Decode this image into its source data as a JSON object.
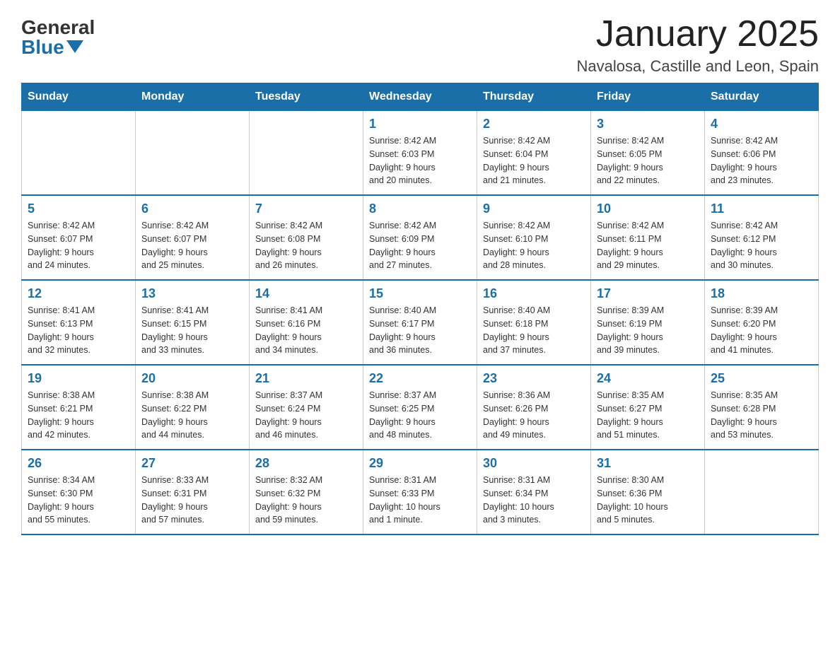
{
  "header": {
    "logo_general": "General",
    "logo_blue": "Blue",
    "month_title": "January 2025",
    "location": "Navalosa, Castille and Leon, Spain"
  },
  "weekdays": [
    "Sunday",
    "Monday",
    "Tuesday",
    "Wednesday",
    "Thursday",
    "Friday",
    "Saturday"
  ],
  "weeks": [
    [
      {
        "day": "",
        "info": ""
      },
      {
        "day": "",
        "info": ""
      },
      {
        "day": "",
        "info": ""
      },
      {
        "day": "1",
        "info": "Sunrise: 8:42 AM\nSunset: 6:03 PM\nDaylight: 9 hours\nand 20 minutes."
      },
      {
        "day": "2",
        "info": "Sunrise: 8:42 AM\nSunset: 6:04 PM\nDaylight: 9 hours\nand 21 minutes."
      },
      {
        "day": "3",
        "info": "Sunrise: 8:42 AM\nSunset: 6:05 PM\nDaylight: 9 hours\nand 22 minutes."
      },
      {
        "day": "4",
        "info": "Sunrise: 8:42 AM\nSunset: 6:06 PM\nDaylight: 9 hours\nand 23 minutes."
      }
    ],
    [
      {
        "day": "5",
        "info": "Sunrise: 8:42 AM\nSunset: 6:07 PM\nDaylight: 9 hours\nand 24 minutes."
      },
      {
        "day": "6",
        "info": "Sunrise: 8:42 AM\nSunset: 6:07 PM\nDaylight: 9 hours\nand 25 minutes."
      },
      {
        "day": "7",
        "info": "Sunrise: 8:42 AM\nSunset: 6:08 PM\nDaylight: 9 hours\nand 26 minutes."
      },
      {
        "day": "8",
        "info": "Sunrise: 8:42 AM\nSunset: 6:09 PM\nDaylight: 9 hours\nand 27 minutes."
      },
      {
        "day": "9",
        "info": "Sunrise: 8:42 AM\nSunset: 6:10 PM\nDaylight: 9 hours\nand 28 minutes."
      },
      {
        "day": "10",
        "info": "Sunrise: 8:42 AM\nSunset: 6:11 PM\nDaylight: 9 hours\nand 29 minutes."
      },
      {
        "day": "11",
        "info": "Sunrise: 8:42 AM\nSunset: 6:12 PM\nDaylight: 9 hours\nand 30 minutes."
      }
    ],
    [
      {
        "day": "12",
        "info": "Sunrise: 8:41 AM\nSunset: 6:13 PM\nDaylight: 9 hours\nand 32 minutes."
      },
      {
        "day": "13",
        "info": "Sunrise: 8:41 AM\nSunset: 6:15 PM\nDaylight: 9 hours\nand 33 minutes."
      },
      {
        "day": "14",
        "info": "Sunrise: 8:41 AM\nSunset: 6:16 PM\nDaylight: 9 hours\nand 34 minutes."
      },
      {
        "day": "15",
        "info": "Sunrise: 8:40 AM\nSunset: 6:17 PM\nDaylight: 9 hours\nand 36 minutes."
      },
      {
        "day": "16",
        "info": "Sunrise: 8:40 AM\nSunset: 6:18 PM\nDaylight: 9 hours\nand 37 minutes."
      },
      {
        "day": "17",
        "info": "Sunrise: 8:39 AM\nSunset: 6:19 PM\nDaylight: 9 hours\nand 39 minutes."
      },
      {
        "day": "18",
        "info": "Sunrise: 8:39 AM\nSunset: 6:20 PM\nDaylight: 9 hours\nand 41 minutes."
      }
    ],
    [
      {
        "day": "19",
        "info": "Sunrise: 8:38 AM\nSunset: 6:21 PM\nDaylight: 9 hours\nand 42 minutes."
      },
      {
        "day": "20",
        "info": "Sunrise: 8:38 AM\nSunset: 6:22 PM\nDaylight: 9 hours\nand 44 minutes."
      },
      {
        "day": "21",
        "info": "Sunrise: 8:37 AM\nSunset: 6:24 PM\nDaylight: 9 hours\nand 46 minutes."
      },
      {
        "day": "22",
        "info": "Sunrise: 8:37 AM\nSunset: 6:25 PM\nDaylight: 9 hours\nand 48 minutes."
      },
      {
        "day": "23",
        "info": "Sunrise: 8:36 AM\nSunset: 6:26 PM\nDaylight: 9 hours\nand 49 minutes."
      },
      {
        "day": "24",
        "info": "Sunrise: 8:35 AM\nSunset: 6:27 PM\nDaylight: 9 hours\nand 51 minutes."
      },
      {
        "day": "25",
        "info": "Sunrise: 8:35 AM\nSunset: 6:28 PM\nDaylight: 9 hours\nand 53 minutes."
      }
    ],
    [
      {
        "day": "26",
        "info": "Sunrise: 8:34 AM\nSunset: 6:30 PM\nDaylight: 9 hours\nand 55 minutes."
      },
      {
        "day": "27",
        "info": "Sunrise: 8:33 AM\nSunset: 6:31 PM\nDaylight: 9 hours\nand 57 minutes."
      },
      {
        "day": "28",
        "info": "Sunrise: 8:32 AM\nSunset: 6:32 PM\nDaylight: 9 hours\nand 59 minutes."
      },
      {
        "day": "29",
        "info": "Sunrise: 8:31 AM\nSunset: 6:33 PM\nDaylight: 10 hours\nand 1 minute."
      },
      {
        "day": "30",
        "info": "Sunrise: 8:31 AM\nSunset: 6:34 PM\nDaylight: 10 hours\nand 3 minutes."
      },
      {
        "day": "31",
        "info": "Sunrise: 8:30 AM\nSunset: 6:36 PM\nDaylight: 10 hours\nand 5 minutes."
      },
      {
        "day": "",
        "info": ""
      }
    ]
  ]
}
